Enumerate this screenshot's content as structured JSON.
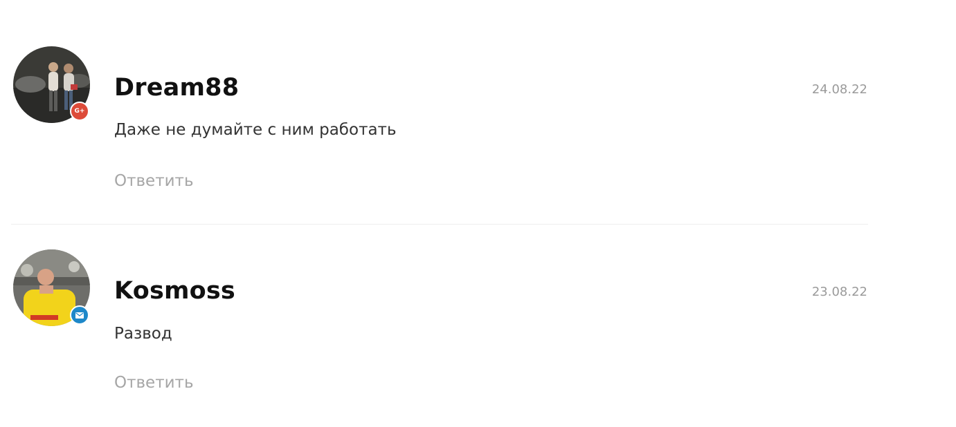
{
  "comments": [
    {
      "author": "Dream88",
      "date": "24.08.22",
      "text": "Даже не думайте с ним работать",
      "reply_label": "Ответить",
      "badge": {
        "icon": "google-plus-icon",
        "label": "G+",
        "color": "#dd4b39"
      }
    },
    {
      "author": "Kosmoss",
      "date": "23.08.22",
      "text": "Развод",
      "reply_label": "Ответить",
      "badge": {
        "icon": "mail-icon",
        "label": "",
        "color": "#1e88c9"
      }
    }
  ]
}
